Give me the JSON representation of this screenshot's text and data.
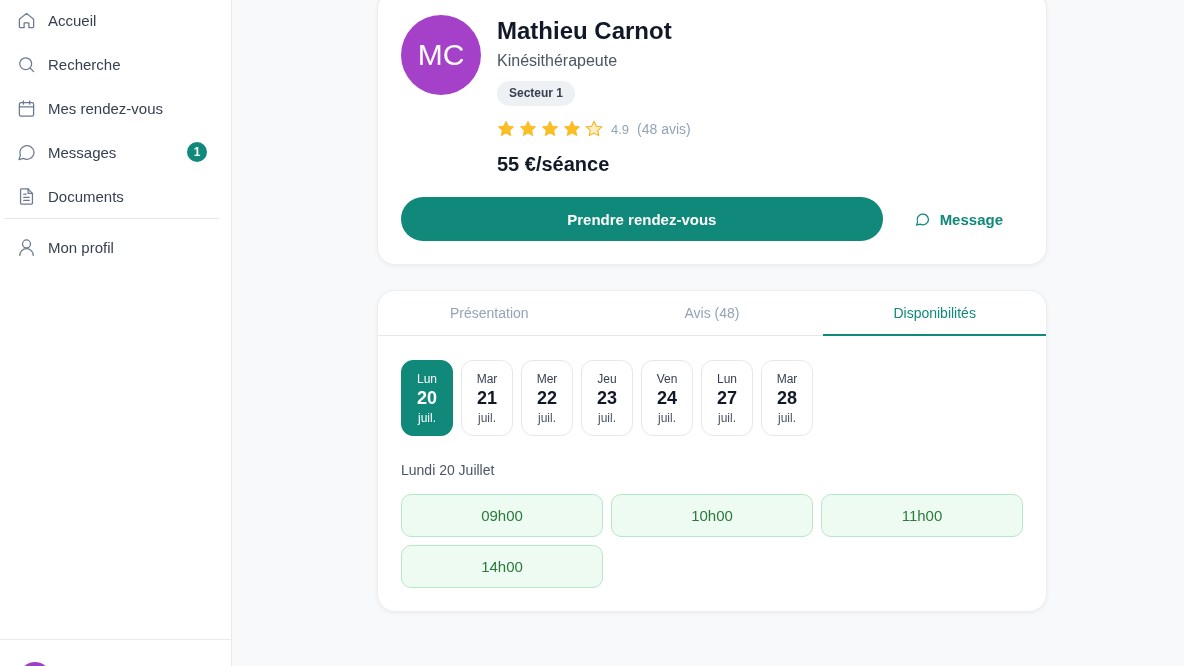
{
  "sidebar": {
    "items": [
      {
        "label": "Accueil",
        "selected": false
      },
      {
        "label": "Recherche",
        "selected": false
      },
      {
        "label": "Mes rendez-vous",
        "selected": false
      },
      {
        "label": "Messages",
        "selected": false,
        "badge": "1"
      },
      {
        "label": "Documents",
        "selected": false
      }
    ],
    "secondary_items": [
      {
        "label": "Mon profil",
        "selected": false
      }
    ]
  },
  "profile": {
    "initials": "MC",
    "name": "Mathieu Carnot",
    "specialty": "Kinésithérapeute",
    "tag": "Secteur 1",
    "stars": 4,
    "rating": "4.9",
    "reviews": "(48 avis)",
    "price": "55 €/séance",
    "book_button": "Prendre rendez-vous",
    "message_button": "Message"
  },
  "details": {
    "tabs": [
      {
        "label": "Présentation",
        "selected": false
      },
      {
        "label": "Avis (48)",
        "selected": false
      },
      {
        "label": "Disponibilités",
        "selected": true
      }
    ],
    "dates": [
      {
        "weekday": "Lun",
        "day": "20",
        "month": "juil.",
        "selected": true
      },
      {
        "weekday": "Mar",
        "day": "21",
        "month": "juil.",
        "selected": false
      },
      {
        "weekday": "Mer",
        "day": "22",
        "month": "juil.",
        "selected": false
      },
      {
        "weekday": "Jeu",
        "day": "23",
        "month": "juil.",
        "selected": false
      },
      {
        "weekday": "Ven",
        "day": "24",
        "month": "juil.",
        "selected": false
      },
      {
        "weekday": "Lun",
        "day": "27",
        "month": "juil.",
        "selected": false
      },
      {
        "weekday": "Mar",
        "day": "28",
        "month": "juil.",
        "selected": false
      }
    ],
    "date_heading": "Lundi 20 Juillet",
    "slots": [
      "09h00",
      "10h00",
      "11h00",
      "14h00"
    ]
  }
}
